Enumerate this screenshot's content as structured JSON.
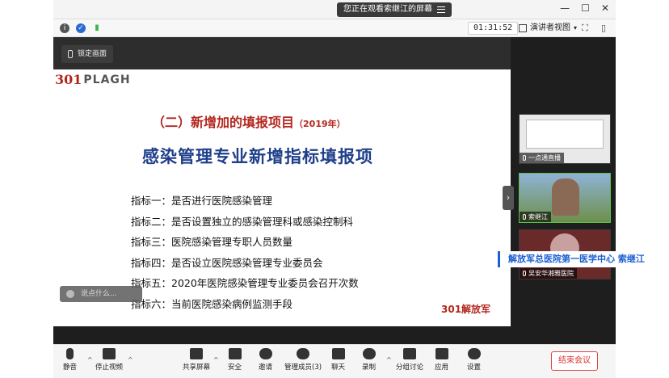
{
  "window": {
    "viewing_label": "您正在观看索继江的屏幕",
    "controls": [
      "—",
      "☐",
      "✕"
    ]
  },
  "infobar": {
    "timer": "01:31:52",
    "view_mode": "演讲者视图"
  },
  "share": {
    "lock_label": "锁定画面"
  },
  "slide": {
    "logo_text": "PLAGH",
    "subtitle": "（二）新增加的填报项目",
    "subtitle_year": "（2019年）",
    "title": "感染管理专业新增指标填报项",
    "indicators": [
      "指标一：是否进行医院感染管理",
      "指标二：是否设置独立的感染管理科或感染控制科",
      "指标三：医院感染管理专职人员数量",
      "指标四：是否设立医院感染管理专业委员会",
      "指标五：2020年医院感染管理专业委员会召开次数",
      "指标六：当前医院感染病例监测手段"
    ],
    "corner_logo": "301解放军"
  },
  "chat_hint": "说点什么...",
  "participants": [
    {
      "name": "一点通直播"
    },
    {
      "name": "索继江"
    },
    {
      "name": "吴安华湘雅医院"
    }
  ],
  "name_banner": "解放军总医院第一医学中心  索继江",
  "toolbar": {
    "mute": "静音",
    "stop_video": "停止视频",
    "share": "共享屏幕",
    "security": "安全",
    "invite": "邀请",
    "participants": "管理成员(3)",
    "chat": "聊天",
    "record": "录制",
    "breakout": "分组讨论",
    "apps": "应用",
    "settings": "设置",
    "end": "结束会议"
  }
}
